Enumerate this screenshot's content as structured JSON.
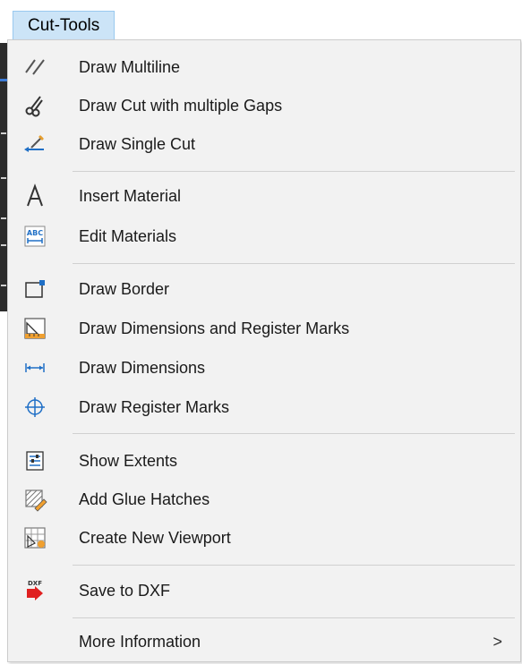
{
  "menubar": {
    "title": "Cut-Tools"
  },
  "menu": {
    "items": [
      {
        "label": "Draw Multiline",
        "icon": "multiline-icon"
      },
      {
        "label": "Draw Cut with multiple Gaps",
        "icon": "scissors-icon"
      },
      {
        "label": "Draw Single Cut",
        "icon": "single-cut-icon"
      },
      {
        "label": "Insert Material",
        "icon": "letter-a-icon"
      },
      {
        "label": "Edit Materials",
        "icon": "abc-dimension-icon"
      },
      {
        "label": "Draw Border",
        "icon": "border-rectangle-icon"
      },
      {
        "label": "Draw Dimensions and Register Marks",
        "icon": "ruler-triangle-icon"
      },
      {
        "label": "Draw Dimensions",
        "icon": "dimension-arrows-icon"
      },
      {
        "label": "Draw Register Marks",
        "icon": "crosshair-icon"
      },
      {
        "label": "Show Extents",
        "icon": "extents-list-icon"
      },
      {
        "label": "Add Glue Hatches",
        "icon": "hatch-pencil-icon"
      },
      {
        "label": "Create New Viewport",
        "icon": "viewport-grid-icon"
      },
      {
        "label": "Save to DXF",
        "icon": "dxf-export-icon",
        "icon_text": "DXF"
      },
      {
        "label": "More Information",
        "icon": "",
        "submenu_arrow": ">"
      }
    ]
  },
  "colors": {
    "menubar_highlight": "#cce4f7",
    "menu_background": "#f2f2f2",
    "icon_blue": "#1f6fc6",
    "icon_red": "#e02020",
    "icon_orange": "#f0a030"
  }
}
